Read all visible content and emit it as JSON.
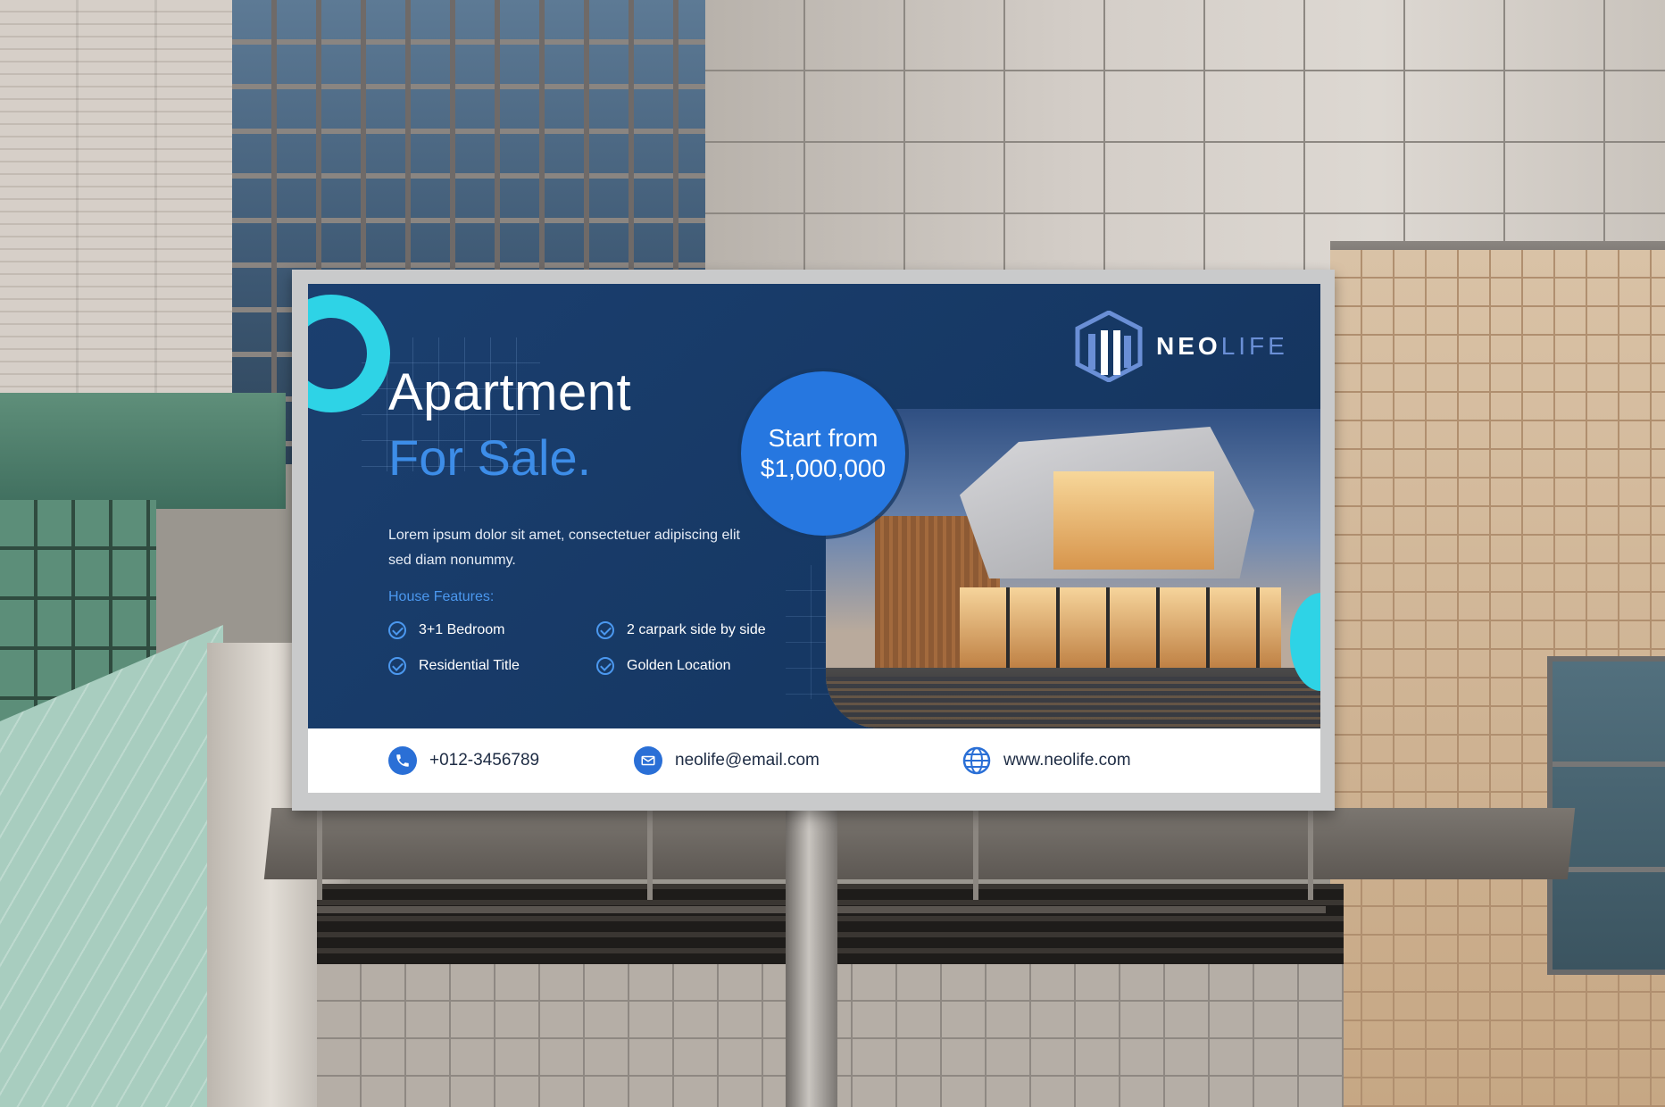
{
  "billboard": {
    "headline_line1": "Apartment",
    "headline_line2": "For Sale.",
    "description": "Lorem ipsum dolor sit amet, consectetuer adipiscing elit sed diam nonummy.",
    "features_label": "House Features:",
    "features": [
      "3+1 Bedroom",
      "2 carpark side by side",
      "Residential Title",
      "Golden Location"
    ],
    "price_line1": "Start from",
    "price_line2": "$1,000,000",
    "logo_neo": "NEO",
    "logo_life": "LIFE",
    "phone": "+012-3456789",
    "email": "neolife@email.com",
    "website": "www.neolife.com",
    "colors": {
      "navy": "#173a66",
      "accent_blue": "#2677e0",
      "cyan": "#2ed3e6",
      "light_blue_text": "#3d8de8"
    },
    "icons": [
      "check-icon",
      "phone-icon",
      "mail-icon",
      "globe-icon",
      "logo-mark-icon"
    ]
  }
}
